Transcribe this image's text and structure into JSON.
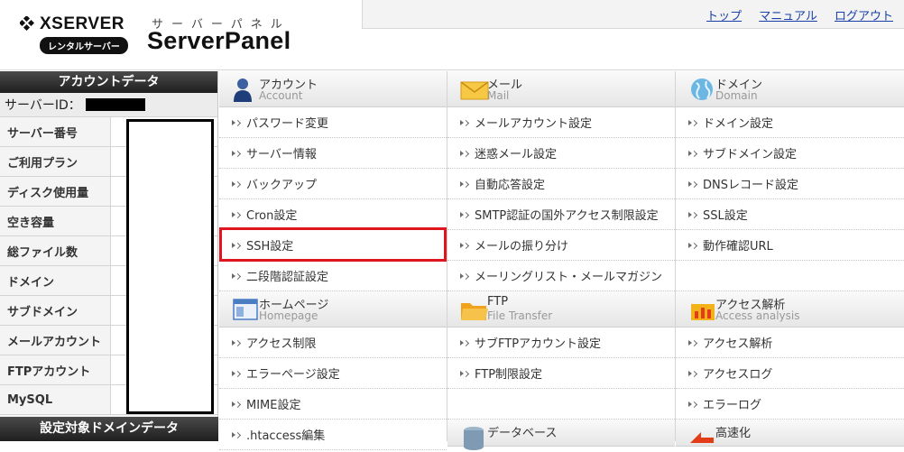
{
  "header": {
    "brand": "XSERVER",
    "badge": "レンタルサーバー",
    "kana": "サーバーパネル",
    "title": "ServerPanel",
    "links": [
      "トップ",
      "マニュアル",
      "ログアウト"
    ]
  },
  "sidebar": {
    "title": "アカウントデータ",
    "server_id_label": "サーバーID：",
    "rows": [
      "サーバー番号",
      "ご利用プラン",
      "ディスク使用量",
      "空き容量",
      "総ファイル数",
      "ドメイン",
      "サブドメイン",
      "メールアカウント",
      "FTPアカウント",
      "MySQL"
    ],
    "footer_title": "設定対象ドメインデータ"
  },
  "account": {
    "jp": "アカウント",
    "en": "Account",
    "items": [
      "パスワード変更",
      "サーバー情報",
      "バックアップ",
      "Cron設定",
      "SSH設定",
      "二段階認証設定"
    ]
  },
  "mail": {
    "jp": "メール",
    "en": "Mail",
    "items": [
      "メールアカウント設定",
      "迷惑メール設定",
      "自動応答設定",
      "SMTP認証の国外アクセス制限設定",
      "メールの振り分け",
      "メーリングリスト・メールマガジン"
    ]
  },
  "domain": {
    "jp": "ドメイン",
    "en": "Domain",
    "items": [
      "ドメイン設定",
      "サブドメイン設定",
      "DNSレコード設定",
      "SSL設定",
      "動作確認URL"
    ]
  },
  "homepage": {
    "jp": "ホームページ",
    "en": "Homepage",
    "items": [
      "アクセス制限",
      "エラーページ設定",
      "MIME設定",
      ".htaccess編集"
    ]
  },
  "ftp": {
    "jp": "FTP",
    "en": "File Transfer",
    "items": [
      "サブFTPアカウント設定",
      "FTP制限設定"
    ]
  },
  "access": {
    "jp": "アクセス解析",
    "en": "Access analysis",
    "items": [
      "アクセス解析",
      "アクセスログ",
      "エラーログ"
    ]
  },
  "database": {
    "jp": "データベース"
  },
  "speed": {
    "jp": "高速化"
  }
}
